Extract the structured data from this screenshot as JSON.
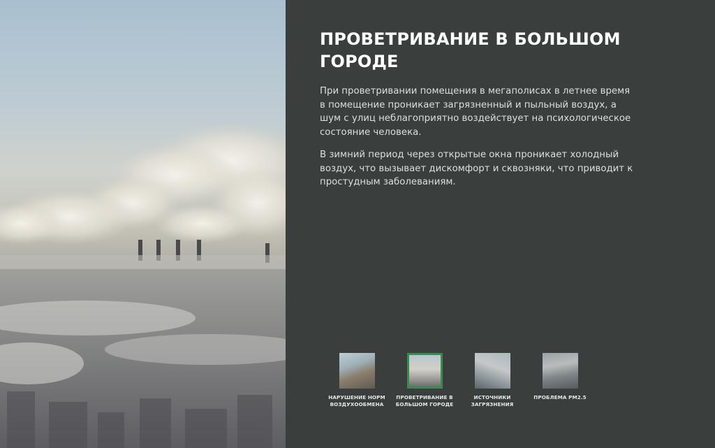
{
  "section": {
    "title": "ПРОВЕТРИВАНИЕ В БОЛЬШОМ ГОРОДЕ",
    "paragraphs": [
      "При проветривании помещения в мегаполисах в летнее время в помещение проникает загрязненный и пыльный воздух, а шум с улиц неблагоприятно воздействует на психологическое состояние человека.",
      "В зимний период через открытые окна проникает холодный воздух, что вызывает дискомфорт и сквозняки, что приводит к простудным заболеваниям."
    ]
  },
  "thumbnails": [
    {
      "label": "НАРУШЕНИЕ НОРМ ВОЗДУХООБМЕНА",
      "active": false
    },
    {
      "label": "ПРОВЕТРИВАНИЕ В БОЛЬШОМ ГОРОДЕ",
      "active": true
    },
    {
      "label": "ИСТОЧНИКИ ЗАГРЯЗНЕНИЯ",
      "active": false
    },
    {
      "label": "ПРОБЛЕМА PM2.5",
      "active": false
    }
  ],
  "colors": {
    "panel_background": "#3a3f3d",
    "active_border": "#1f9a3e",
    "title_text": "#ffffff"
  }
}
